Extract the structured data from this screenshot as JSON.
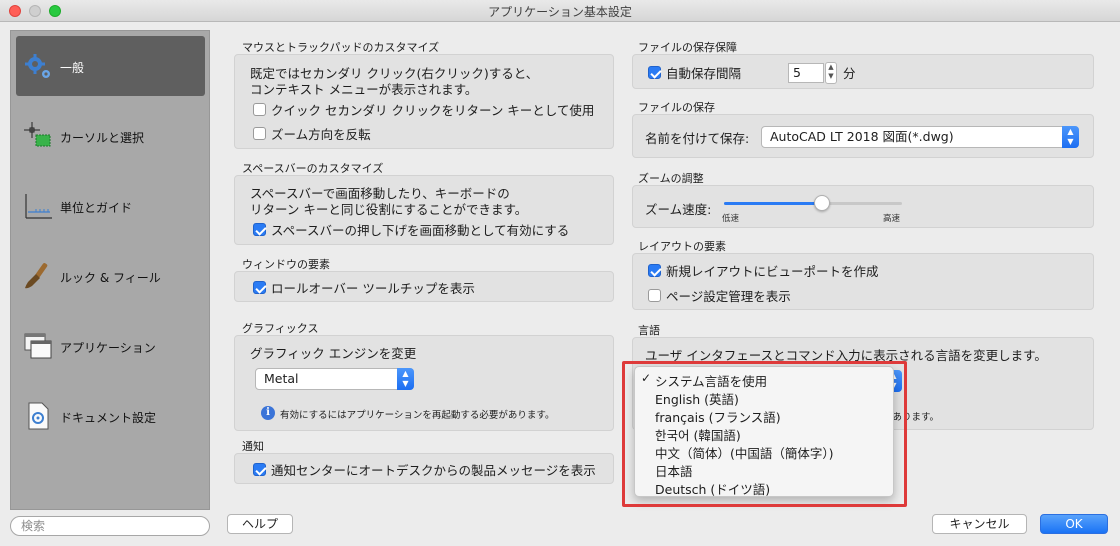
{
  "window": {
    "title": "アプリケーション基本設定"
  },
  "sidebar": {
    "items": [
      {
        "label": "一般",
        "icon": "gear-icon"
      },
      {
        "label": "カーソルと選択",
        "icon": "cursor-selection-icon"
      },
      {
        "label": "単位とガイド",
        "icon": "ruler-icon"
      },
      {
        "label": "ルック & フィール",
        "icon": "paintbrush-icon"
      },
      {
        "label": "アプリケーション",
        "icon": "windows-icon"
      },
      {
        "label": "ドキュメント設定",
        "icon": "document-icon"
      }
    ]
  },
  "search": {
    "placeholder": "検索"
  },
  "buttons": {
    "help": "ヘルプ",
    "cancel": "キャンセル",
    "ok": "OK"
  },
  "mouse": {
    "title": "マウスとトラックパッドのカスタマイズ",
    "desc1": "既定ではセカンダリ クリック(右クリック)すると、",
    "desc2": "コンテキスト メニューが表示されます。",
    "cb1": "クイック セカンダリ クリックをリターン キーとして使用",
    "cb2": "ズーム方向を反転"
  },
  "space": {
    "title": "スペースバーのカスタマイズ",
    "desc1": "スペースバーで画面移動したり、キーボードの",
    "desc2": "リターン キーと同じ役割にすることができます。",
    "cb1": "スペースバーの押し下げを画面移動として有効にする"
  },
  "window_elements": {
    "title": "ウィンドウの要素",
    "cb1": "ロールオーバー ツールチップを表示"
  },
  "graphics": {
    "title": "グラフィックス",
    "label": "グラフィック エンジンを変更",
    "engine": "Metal",
    "note": "有効にするにはアプリケーションを再起動する必要があります。"
  },
  "notify": {
    "title": "通知",
    "cb1": "通知センターにオートデスクからの製品メッセージを表示"
  },
  "save_protect": {
    "title": "ファイルの保存保障",
    "cb1": "自動保存間隔",
    "value": "5",
    "unit": "分"
  },
  "file_save": {
    "title": "ファイルの保存",
    "label": "名前を付けて保存:",
    "format": "AutoCAD LT 2018 図面(*.dwg)"
  },
  "zoom": {
    "title": "ズームの調整",
    "label": "ズーム速度:",
    "low": "低速",
    "high": "高速",
    "level": 0.55
  },
  "layout": {
    "title": "レイアウトの要素",
    "cb1": "新規レイアウトにビューポートを作成",
    "cb2": "ページ設定管理を表示"
  },
  "language": {
    "title": "言語",
    "desc": "ユーザ インタフェースとコマンド入力に表示される言語を変更します。",
    "note_tail": "があります。",
    "options": [
      "システム言語を使用",
      "English (英語)",
      "français (フランス語)",
      "한국어 (韓国語)",
      "中文（简体）(中国語（簡体字）)",
      "日本語",
      "Deutsch (ドイツ語)"
    ],
    "selected": "システム言語を使用"
  }
}
